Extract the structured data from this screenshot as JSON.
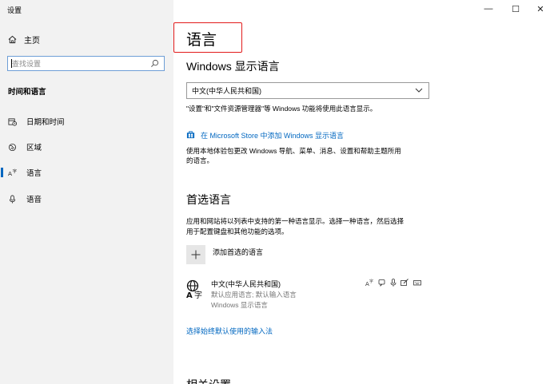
{
  "window": {
    "title": "设置",
    "controls": {
      "minimize": "—",
      "maximize": "☐",
      "close": "✕"
    }
  },
  "sidebar": {
    "home_label": "主页",
    "search_placeholder": "查找设置",
    "section_title": "时间和语言",
    "items": [
      {
        "label": "日期和时间",
        "icon": "date-time-icon"
      },
      {
        "label": "区域",
        "icon": "region-globe-icon"
      },
      {
        "label": "语言",
        "icon": "language-icon",
        "active": true
      },
      {
        "label": "语音",
        "icon": "microphone-icon"
      }
    ]
  },
  "main": {
    "title": "语言",
    "display_language": {
      "heading": "Windows 显示语言",
      "selected": "中文(中华人民共和国)",
      "note": "\"设置\"和\"文件资源管理器\"等 Windows 功能将使用此语言显示。",
      "store_link": "在 Microsoft Store 中添加 Windows 显示语言",
      "store_note_line1": "使用本地体验包更改 Windows 导航、菜单、消息、设置和帮助主题所用",
      "store_note_line2": "的语言。"
    },
    "preferred": {
      "heading": "首选语言",
      "note_line1": "应用和网站将以列表中支持的第一种语言显示。选择一种语言，然后选择",
      "note_line2": "用于配置键盘和其他功能的选项。",
      "add_label": "添加首选的语言",
      "languages": [
        {
          "name": "中文(中华人民共和国)",
          "detail1": "默认应用语言; 默认输入语言",
          "detail2": "Windows 显示语言",
          "features": [
            "language-pack-icon",
            "speech-icon",
            "microphone-icon",
            "handwriting-icon",
            "keyboard-icon"
          ]
        }
      ]
    },
    "input_method_link": "选择始终默认使用的输入法",
    "next_heading": "相关设置"
  },
  "colors": {
    "accent": "#0067c0",
    "sidebar_bg": "#f2f2f2",
    "highlight_box": "#e21b1b"
  }
}
